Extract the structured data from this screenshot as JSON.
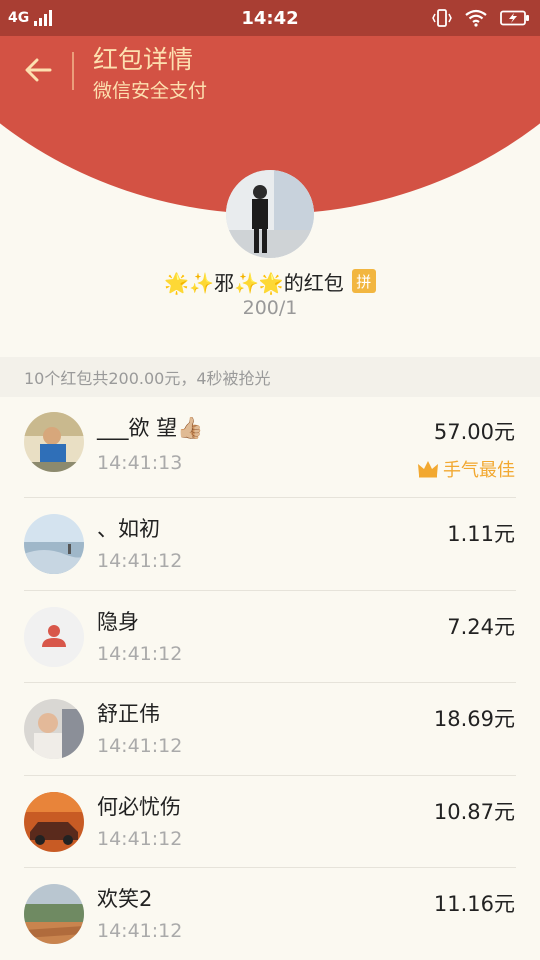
{
  "status_bar": {
    "network": "4G",
    "time": "14:42"
  },
  "header": {
    "title": "红包详情",
    "subtitle": "微信安全支付"
  },
  "sender": {
    "name": "🌟✨邪✨🌟的红包",
    "badge": "拼",
    "count": "200/1"
  },
  "summary": "10个红包共200.00元，4秒被抢光",
  "records": [
    {
      "name": "___欲 望👍🏼",
      "time": "14:41:13",
      "amount": "57.00元",
      "best": "手气最佳"
    },
    {
      "name": "、如初",
      "time": "14:41:12",
      "amount": "1.11元"
    },
    {
      "name": "隐身",
      "time": "14:41:12",
      "amount": "7.24元"
    },
    {
      "name": "舒正伟",
      "time": "14:41:12",
      "amount": "18.69元"
    },
    {
      "name": "何必忧伤",
      "time": "14:41:12",
      "amount": "10.87元"
    },
    {
      "name": "欢笑2",
      "time": "14:41:12",
      "amount": "11.16元"
    }
  ],
  "colors": {
    "header_red": "#d35244",
    "header_text": "#fde0b0",
    "best_gold": "#f2a830"
  }
}
